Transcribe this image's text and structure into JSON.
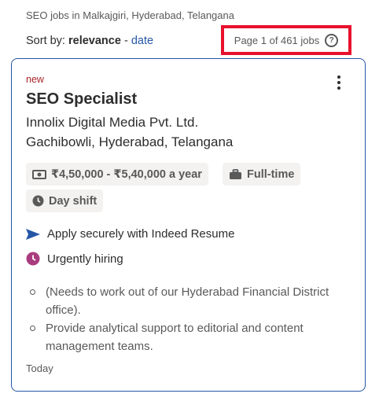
{
  "header": {
    "breadcrumb": "SEO jobs in Malkajgiri, Hyderabad, Telangana",
    "sort_prefix": "Sort by:",
    "sort_active": "relevance",
    "sort_separator": "-",
    "sort_alt": "date",
    "page_info": "Page 1 of 461 jobs",
    "help_glyph": "?"
  },
  "job": {
    "tag": "new",
    "title": "SEO Specialist",
    "company": "Innolix Digital Media Pvt. Ltd.",
    "location": "Gachibowli, Hyderabad, Telangana",
    "chips": [
      {
        "label": "₹4,50,000 - ₹5,40,000 a year",
        "icon": "salary-icon"
      },
      {
        "label": "Full-time",
        "icon": "briefcase-icon"
      },
      {
        "label": "Day shift",
        "icon": "clock-icon"
      }
    ],
    "apply_text": "Apply securely with Indeed Resume",
    "urgent_text": "Urgently hiring",
    "bullets": [
      "(Needs to work out of our Hyderabad Financial District office).",
      "Provide analytical support to editorial and content management teams."
    ],
    "posted": "Today"
  },
  "colors": {
    "accent": "#2557a7",
    "highlight_box": "#e8112d",
    "new_tag": "#a9252b",
    "urgent": "#a93c7e"
  }
}
